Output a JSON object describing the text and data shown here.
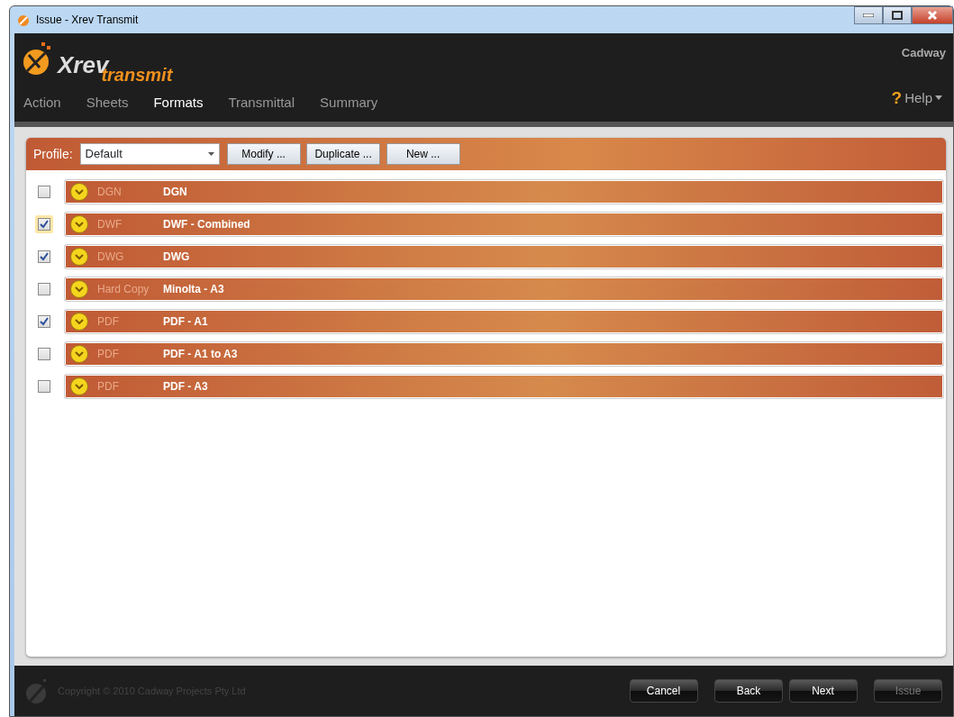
{
  "window": {
    "title": "Issue - Xrev Transmit"
  },
  "logo": {
    "name": "Xrev",
    "tagline": "transmit"
  },
  "brand": "Cadway",
  "tabs": [
    {
      "label": "Action",
      "selected": false
    },
    {
      "label": "Sheets",
      "selected": false
    },
    {
      "label": "Formats",
      "selected": true
    },
    {
      "label": "Transmittal",
      "selected": false
    },
    {
      "label": "Summary",
      "selected": false
    }
  ],
  "help": {
    "icon": "?",
    "label": "Help"
  },
  "profile": {
    "label": "Profile:",
    "value": "Default",
    "buttons": [
      "Modify ...",
      "Duplicate ...",
      "New ..."
    ]
  },
  "formats": [
    {
      "type": "DGN",
      "name": "DGN",
      "checked": false,
      "focused": false
    },
    {
      "type": "DWF",
      "name": "DWF - Combined",
      "checked": true,
      "focused": true
    },
    {
      "type": "DWG",
      "name": "DWG",
      "checked": true,
      "focused": false
    },
    {
      "type": "Hard Copy",
      "name": "Minolta - A3",
      "checked": false,
      "focused": false
    },
    {
      "type": "PDF",
      "name": "PDF - A1",
      "checked": true,
      "focused": false
    },
    {
      "type": "PDF",
      "name": "PDF - A1 to A3",
      "checked": false,
      "focused": false
    },
    {
      "type": "PDF",
      "name": "PDF - A3",
      "checked": false,
      "focused": false
    }
  ],
  "footer": {
    "copyright": "Copyright © 2010 Cadway Projects Pty Ltd",
    "buttons": [
      {
        "label": "Cancel",
        "disabled": false
      },
      {
        "label": "Back",
        "disabled": false
      },
      {
        "label": "Next",
        "disabled": false
      },
      {
        "label": "Issue",
        "disabled": true
      }
    ]
  }
}
